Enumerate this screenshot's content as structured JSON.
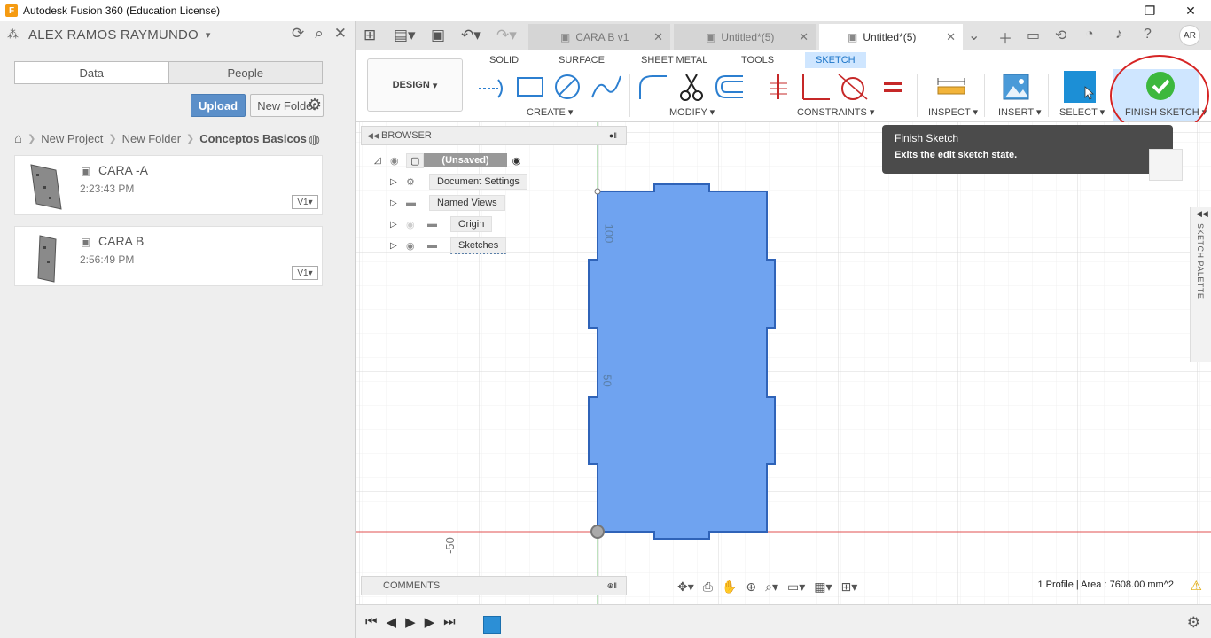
{
  "window": {
    "app_icon": "F",
    "title": "Autodesk Fusion 360 (Education License)",
    "minimize": "—",
    "restore": "❐",
    "close": "✕"
  },
  "left_panel": {
    "user_name": "ALEX RAMOS RAYMUNDO",
    "tabs": [
      "Data",
      "People"
    ],
    "upload_label": "Upload",
    "new_folder_label": "New Folder",
    "breadcrumb": [
      "New Project",
      "New Folder",
      "Conceptos Basicos"
    ],
    "files": [
      {
        "name": "CARA -A",
        "time": "2:23:43 PM",
        "version": "V1"
      },
      {
        "name": "CARA B",
        "time": "2:56:49 PM",
        "version": "V1"
      }
    ]
  },
  "tabs": [
    {
      "label": "CARA B v1",
      "active": false
    },
    {
      "label": "Untitled*(5)",
      "active": false
    },
    {
      "label": "Untitled*(5)",
      "active": true
    }
  ],
  "avatar_initials": "AR",
  "toolbar": {
    "workspace": "DESIGN",
    "tabs": [
      "SOLID",
      "SURFACE",
      "SHEET METAL",
      "TOOLS",
      "SKETCH"
    ],
    "active_tab": "SKETCH",
    "groups": [
      "CREATE",
      "MODIFY",
      "CONSTRAINTS",
      "INSPECT",
      "INSERT",
      "SELECT",
      "FINISH SKETCH"
    ],
    "accent": "#1b74c7",
    "highlight": "#cfe6ff"
  },
  "browser": {
    "title": "BROWSER",
    "root": "(Unsaved)",
    "items": [
      "Document Settings",
      "Named Views",
      "Origin",
      "Sketches"
    ]
  },
  "tooltip": {
    "title": "Finish Sketch",
    "description": "Exits the edit sketch state."
  },
  "canvas": {
    "dim_labels": [
      "100",
      "50",
      "-50"
    ],
    "profile_color": "#6fa3f0",
    "palette_label": "SKETCH PALETTE"
  },
  "comments_label": "COMMENTS",
  "status": {
    "text": "1 Profile | Area : 7608.00 mm^2"
  }
}
